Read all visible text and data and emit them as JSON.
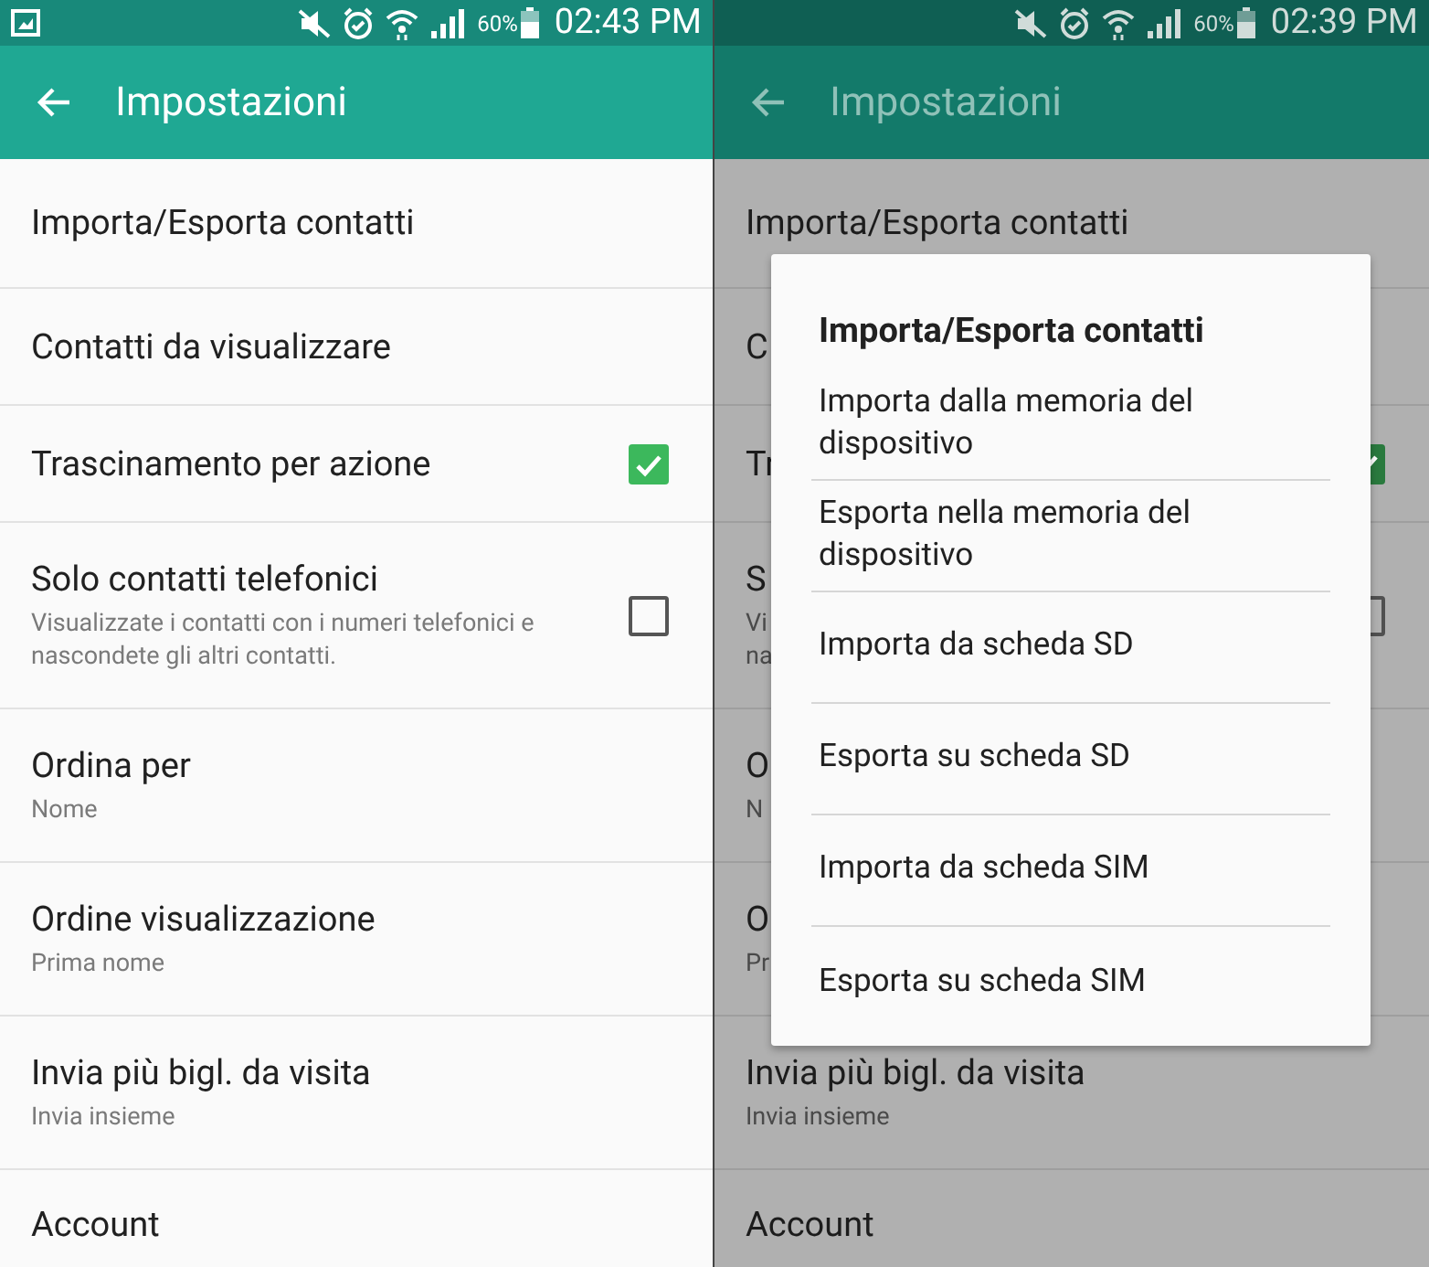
{
  "panels": [
    {
      "dimmed": false,
      "status_bar": {
        "notification_icon": true,
        "battery": "60%",
        "time": "02:43 PM"
      },
      "app_bar": {
        "title": "Impostazioni"
      },
      "items": [
        {
          "title": "Importa/Esporta contatti"
        },
        {
          "title": "Contatti da visualizzare"
        },
        {
          "title": "Trascinamento per azione",
          "kind": "checkbox",
          "checked": true
        },
        {
          "title": "Solo contatti telefonici",
          "subtitle_lines": [
            "Visualizzate i contatti con i numeri telefonici e",
            "nascondete gli altri contatti."
          ],
          "kind": "checkbox",
          "checked": false
        },
        {
          "title": "Ordina per",
          "subtitle_lines": [
            "Nome"
          ]
        },
        {
          "title": "Ordine visualizzazione",
          "subtitle_lines": [
            "Prima nome"
          ]
        },
        {
          "title": "Invia più bigl. da visita",
          "subtitle_lines": [
            "Invia insieme"
          ]
        },
        {
          "title": "Account"
        }
      ]
    },
    {
      "dimmed": true,
      "status_bar": {
        "notification_icon": false,
        "battery": "60%",
        "time": "02:39 PM"
      },
      "app_bar": {
        "title": "Impostazioni"
      },
      "items": [
        {
          "title": "Importa/Esporta contatti"
        },
        {
          "title": "C"
        },
        {
          "title": "Tr",
          "kind": "checkbox",
          "checked": true
        },
        {
          "title": "S",
          "subtitle_lines": [
            "Vi",
            "na"
          ],
          "kind": "checkbox",
          "checked": false
        },
        {
          "title": "O",
          "subtitle_lines": [
            "N"
          ]
        },
        {
          "title": "O",
          "subtitle_lines": [
            "Pr"
          ]
        },
        {
          "title": "Invia più bigl. da visita",
          "subtitle_lines": [
            "Invia insieme"
          ]
        },
        {
          "title": "Account"
        }
      ],
      "dialog": {
        "title": "Importa/Esporta contatti",
        "options": [
          "Importa dalla memoria del dispositivo",
          "Esporta nella memoria del dispositivo",
          "Importa da scheda SD",
          "Esporta su scheda SD",
          "Importa da scheda SIM",
          "Esporta su scheda SIM"
        ]
      }
    }
  ]
}
